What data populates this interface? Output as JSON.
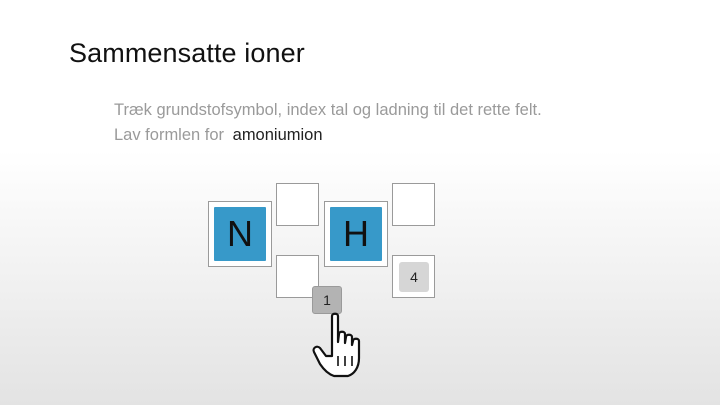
{
  "title": "Sammensatte ioner",
  "instructions": {
    "line1": "Træk grundstofsymbol, index tal og ladning til det rette felt.",
    "line2_prefix": "Lav formlen for",
    "target": "amoniumion"
  },
  "formula": {
    "element1": "N",
    "element2": "H",
    "index_h": "4",
    "dragging_chip": "1"
  },
  "colors": {
    "tile": "#3799c9",
    "chip": "#d6d6d6"
  },
  "cursor_icon": "hand-pointer-icon"
}
